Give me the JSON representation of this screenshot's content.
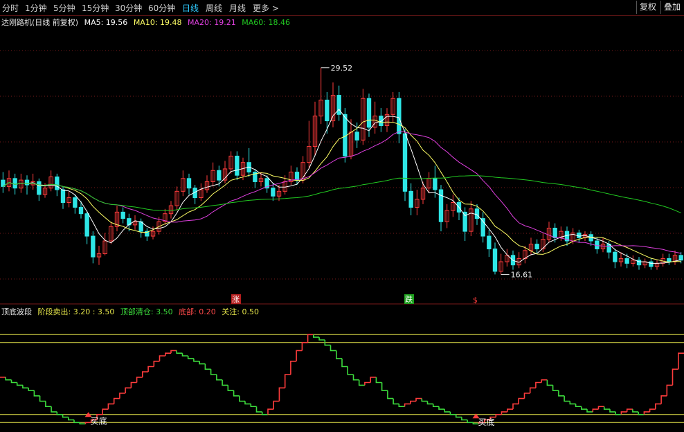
{
  "toolbar": {
    "tabs": [
      "分时",
      "1分钟",
      "5分钟",
      "15分钟",
      "30分钟",
      "60分钟",
      "日线",
      "周线",
      "月线",
      "更多 >"
    ],
    "active_tab": "日线",
    "right_buttons": [
      "复权",
      "叠加"
    ]
  },
  "price_legend": {
    "title": "达刚路机(日线 前复权)",
    "ma5": "MA5: 19.56",
    "ma10": "MA10: 19.48",
    "ma20": "MA20: 19.21",
    "ma60": "MA60: 18.46"
  },
  "indicator_legend": {
    "title": "顶底波段",
    "sell": "阶段卖出: 3.20 : 3.50",
    "clear": "顶部清仓: 3.50",
    "bottom": "底部: 0.20",
    "watch": "关注: 0.50"
  },
  "markers": {
    "high_label": "29.52",
    "low_label": "16.61",
    "rise_tag": "涨",
    "fall_tag": "跌",
    "s_tag": "$",
    "buy_label_1": "买底",
    "buy_label_2": "买底"
  },
  "colors": {
    "bg": "#000000",
    "up": "#ff3c3c",
    "down": "#2ee6e6",
    "ma5": "#ffffff",
    "ma10": "#ffff66",
    "ma20": "#e040e0",
    "ma60": "#22cc22",
    "ind_up": "#ff3c3c",
    "ind_down": "#3cdc3c",
    "ref_line": "#e6e64a",
    "grid": "#7a1a1a"
  },
  "chart_data": {
    "type": "candlestick",
    "price_axis": {
      "ylim": [
        15.5,
        31.5
      ]
    },
    "ma_labels": [
      "MA5",
      "MA10",
      "MA20",
      "MA60"
    ],
    "candles": [
      [
        22.5,
        22.1,
        23.0,
        21.7
      ],
      [
        22.1,
        22.6,
        23.1,
        21.8
      ],
      [
        22.6,
        22.0,
        22.9,
        21.6
      ],
      [
        22.0,
        22.5,
        22.9,
        21.7
      ],
      [
        22.5,
        22.2,
        22.8,
        21.6
      ],
      [
        22.2,
        22.4,
        22.9,
        21.9
      ],
      [
        22.4,
        21.6,
        22.6,
        21.2
      ],
      [
        21.6,
        22.0,
        22.3,
        21.4
      ],
      [
        22.0,
        22.7,
        23.1,
        21.8
      ],
      [
        22.7,
        21.9,
        22.9,
        21.5
      ],
      [
        21.9,
        21.1,
        22.1,
        20.7
      ],
      [
        21.1,
        21.4,
        21.8,
        20.8
      ],
      [
        21.4,
        20.8,
        21.6,
        20.4
      ],
      [
        20.8,
        20.4,
        21.2,
        20.1
      ],
      [
        20.4,
        19.0,
        20.6,
        18.5
      ],
      [
        19.0,
        17.7,
        19.3,
        17.3
      ],
      [
        17.7,
        17.9,
        18.4,
        17.2
      ],
      [
        17.9,
        18.7,
        19.2,
        17.8
      ],
      [
        18.7,
        19.6,
        19.9,
        18.5
      ],
      [
        19.6,
        20.5,
        20.9,
        19.3
      ],
      [
        20.5,
        20.1,
        20.8,
        19.8
      ],
      [
        20.1,
        19.7,
        20.4,
        19.3
      ],
      [
        19.7,
        19.9,
        20.3,
        19.4
      ],
      [
        19.9,
        19.3,
        20.1,
        18.9
      ],
      [
        19.3,
        19.0,
        19.5,
        18.7
      ],
      [
        19.0,
        19.3,
        19.6,
        18.8
      ],
      [
        19.3,
        19.9,
        20.2,
        19.1
      ],
      [
        19.9,
        20.4,
        20.7,
        19.7
      ],
      [
        20.4,
        20.9,
        21.2,
        20.1
      ],
      [
        20.9,
        21.8,
        22.1,
        20.6
      ],
      [
        21.8,
        22.6,
        23.1,
        21.5
      ],
      [
        22.6,
        22.0,
        22.9,
        21.6
      ],
      [
        22.0,
        21.4,
        22.2,
        21.0
      ],
      [
        21.4,
        21.9,
        22.3,
        21.2
      ],
      [
        21.9,
        22.4,
        22.8,
        21.7
      ],
      [
        22.4,
        23.1,
        23.6,
        22.1
      ],
      [
        23.1,
        22.5,
        23.4,
        22.1
      ],
      [
        22.5,
        23.2,
        23.7,
        22.3
      ],
      [
        23.2,
        24.0,
        24.3,
        22.9
      ],
      [
        24.0,
        22.8,
        24.3,
        22.5
      ],
      [
        22.8,
        23.6,
        23.9,
        22.5
      ],
      [
        23.6,
        23.0,
        24.5,
        22.7
      ],
      [
        23.0,
        22.4,
        23.2,
        22.0
      ],
      [
        22.4,
        22.6,
        23.0,
        22.1
      ],
      [
        22.6,
        22.0,
        22.8,
        21.7
      ],
      [
        22.0,
        21.5,
        22.3,
        21.2
      ],
      [
        21.5,
        21.8,
        22.2,
        21.2
      ],
      [
        21.8,
        22.4,
        22.8,
        21.6
      ],
      [
        22.4,
        23.0,
        23.4,
        22.2
      ],
      [
        23.0,
        22.5,
        23.3,
        22.2
      ],
      [
        22.5,
        23.6,
        24.0,
        22.3
      ],
      [
        23.6,
        24.6,
        26.2,
        23.2
      ],
      [
        24.6,
        26.5,
        27.4,
        24.0
      ],
      [
        26.5,
        27.5,
        29.52,
        26.0
      ],
      [
        27.5,
        26.2,
        28.0,
        25.4
      ],
      [
        26.2,
        27.8,
        28.6,
        25.8
      ],
      [
        27.8,
        26.6,
        28.4,
        26.2
      ],
      [
        26.6,
        24.0,
        27.0,
        23.6
      ],
      [
        24.0,
        25.5,
        26.3,
        23.8
      ],
      [
        25.5,
        25.0,
        26.1,
        24.5
      ],
      [
        25.0,
        27.6,
        28.2,
        24.7
      ],
      [
        27.6,
        25.8,
        27.9,
        25.2
      ],
      [
        25.8,
        26.5,
        27.4,
        25.4
      ],
      [
        26.5,
        25.9,
        27.0,
        25.5
      ],
      [
        25.9,
        26.6,
        27.0,
        25.5
      ],
      [
        26.6,
        27.6,
        28.0,
        26.1
      ],
      [
        27.6,
        25.4,
        28.0,
        24.8
      ],
      [
        25.4,
        21.8,
        25.7,
        21.2
      ],
      [
        21.8,
        20.8,
        22.3,
        20.3
      ],
      [
        20.8,
        21.3,
        21.9,
        20.3
      ],
      [
        21.3,
        22.0,
        22.4,
        21.0
      ],
      [
        22.0,
        22.6,
        23.0,
        21.7
      ],
      [
        22.6,
        21.9,
        23.4,
        21.4
      ],
      [
        21.9,
        19.9,
        22.2,
        19.3
      ],
      [
        19.9,
        20.6,
        21.0,
        19.5
      ],
      [
        20.6,
        21.1,
        21.6,
        20.2
      ],
      [
        21.1,
        20.5,
        21.4,
        20.0
      ],
      [
        20.5,
        19.3,
        20.8,
        18.7
      ],
      [
        19.3,
        20.7,
        21.2,
        19.0
      ],
      [
        20.7,
        20.1,
        21.0,
        19.7
      ],
      [
        20.1,
        19.0,
        20.5,
        18.6
      ],
      [
        19.0,
        18.2,
        19.4,
        17.7
      ],
      [
        18.2,
        16.8,
        18.6,
        16.61
      ],
      [
        16.8,
        17.4,
        17.9,
        16.6
      ],
      [
        17.4,
        17.8,
        18.2,
        17.1
      ],
      [
        17.8,
        17.2,
        18.1,
        16.9
      ],
      [
        17.2,
        17.6,
        18.0,
        17.0
      ],
      [
        17.6,
        18.1,
        18.4,
        17.3
      ],
      [
        18.1,
        18.5,
        18.9,
        17.8
      ],
      [
        18.5,
        18.2,
        18.8,
        17.9
      ],
      [
        18.2,
        18.8,
        19.2,
        18.0
      ],
      [
        18.8,
        19.5,
        19.9,
        18.6
      ],
      [
        19.5,
        18.9,
        19.8,
        18.6
      ],
      [
        18.9,
        19.3,
        19.6,
        18.7
      ],
      [
        19.3,
        18.7,
        19.6,
        18.4
      ],
      [
        18.7,
        19.2,
        19.5,
        18.5
      ],
      [
        19.2,
        18.9,
        19.4,
        18.6
      ],
      [
        18.9,
        19.1,
        19.3,
        18.7
      ],
      [
        19.1,
        18.7,
        19.3,
        18.4
      ],
      [
        18.7,
        18.2,
        18.9,
        17.9
      ],
      [
        18.2,
        18.5,
        18.9,
        18.0
      ],
      [
        18.5,
        18.0,
        18.7,
        17.6
      ],
      [
        18.0,
        17.4,
        18.2,
        17.0
      ],
      [
        17.4,
        17.6,
        18.0,
        17.1
      ],
      [
        17.6,
        17.3,
        17.9,
        17.0
      ],
      [
        17.3,
        17.5,
        17.8,
        17.1
      ],
      [
        17.5,
        17.2,
        17.7,
        16.9
      ],
      [
        17.2,
        17.4,
        17.6,
        17.0
      ],
      [
        17.4,
        17.1,
        17.6,
        16.9
      ],
      [
        17.1,
        17.3,
        17.5,
        16.9
      ],
      [
        17.3,
        17.6,
        17.9,
        17.1
      ],
      [
        17.6,
        17.4,
        17.9,
        17.2
      ],
      [
        17.4,
        17.8,
        18.1,
        17.2
      ],
      [
        17.8,
        17.5,
        18.0,
        17.3
      ]
    ],
    "indicator": {
      "name": "顶底波段",
      "ylim": [
        0,
        4
      ],
      "ref_levels": [
        3.5,
        3.2,
        0.5,
        0.2
      ],
      "values": [
        1.9,
        1.8,
        1.7,
        1.6,
        1.5,
        1.4,
        1.2,
        1.0,
        0.8,
        0.6,
        0.5,
        0.4,
        0.3,
        0.2,
        0.15,
        0.2,
        0.3,
        0.5,
        0.7,
        0.9,
        1.1,
        1.3,
        1.5,
        1.7,
        1.9,
        2.1,
        2.3,
        2.5,
        2.7,
        2.8,
        2.9,
        2.8,
        2.7,
        2.6,
        2.5,
        2.4,
        2.2,
        2.0,
        1.8,
        1.6,
        1.4,
        1.2,
        1.0,
        0.9,
        0.8,
        0.6,
        0.5,
        0.7,
        1.0,
        1.5,
        2.0,
        2.5,
        2.9,
        3.2,
        3.5,
        3.4,
        3.3,
        3.1,
        2.9,
        2.6,
        2.3,
        2.0,
        1.8,
        1.6,
        1.7,
        1.9,
        1.7,
        1.4,
        1.1,
        0.9,
        0.8,
        0.9,
        1.0,
        1.1,
        1.0,
        0.9,
        0.8,
        0.7,
        0.6,
        0.5,
        0.4,
        0.3,
        0.2,
        0.15,
        0.2,
        0.3,
        0.4,
        0.5,
        0.6,
        0.7,
        0.9,
        1.1,
        1.3,
        1.5,
        1.7,
        1.8,
        1.6,
        1.4,
        1.2,
        1.0,
        0.9,
        0.8,
        0.7,
        0.6,
        0.7,
        0.8,
        0.7,
        0.6,
        0.5,
        0.6,
        0.7,
        0.6,
        0.5,
        0.6,
        0.7,
        0.9,
        1.2,
        1.6,
        2.2,
        2.8
      ]
    }
  }
}
